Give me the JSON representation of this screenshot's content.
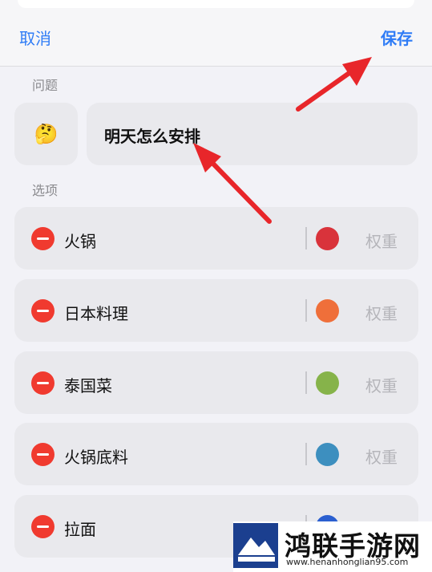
{
  "nav": {
    "cancel_label": "取消",
    "save_label": "保存"
  },
  "question": {
    "section_label": "问题",
    "emoji": "🤔",
    "text": "明天怎么安排"
  },
  "options": {
    "section_label": "选项",
    "weight_label": "权重",
    "items": [
      {
        "label": "火锅",
        "color": "#d9333b"
      },
      {
        "label": "日本料理",
        "color": "#ef6f3a"
      },
      {
        "label": "泰国菜",
        "color": "#86b34a"
      },
      {
        "label": "火锅底料",
        "color": "#3d8fbf"
      },
      {
        "label": "拉面",
        "color": "#2b5fd0"
      }
    ]
  },
  "colors": {
    "accent": "#2f7cf6",
    "remove": "#f03a2f",
    "annotation_arrow": "#e8262a"
  },
  "watermark": {
    "brand": "鸿联手游网",
    "url": "www.henanhonglian95.com"
  }
}
